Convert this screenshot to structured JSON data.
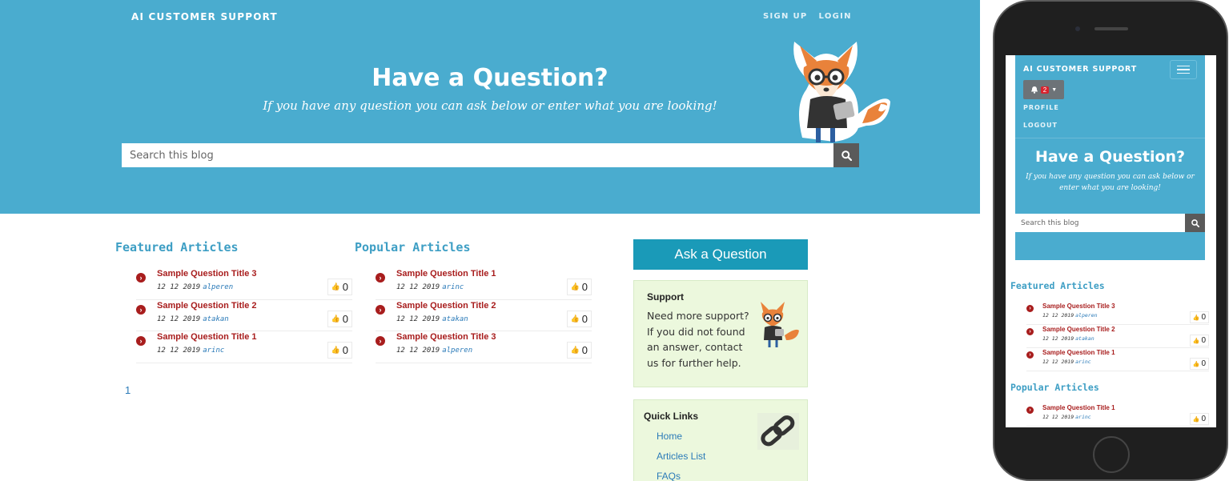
{
  "site": {
    "brand": "AI CUSTOMER SUPPORT",
    "nav": [
      "SIGN UP",
      "LOGIN"
    ]
  },
  "hero": {
    "title": "Have a Question?",
    "subtitle": "If you have any question you can ask below or enter what you are looking!",
    "search_placeholder": "Search this blog"
  },
  "featured": {
    "heading": "Featured Articles",
    "items": [
      {
        "title": "Sample Question Title 3",
        "date": "12 12 2019",
        "author": "alperen",
        "votes": "0"
      },
      {
        "title": "Sample Question Title 2",
        "date": "12 12 2019",
        "author": "atakan",
        "votes": "0"
      },
      {
        "title": "Sample Question Title 1",
        "date": "12 12 2019",
        "author": "arinc",
        "votes": "0"
      }
    ]
  },
  "popular": {
    "heading": "Popular Articles",
    "items": [
      {
        "title": "Sample Question Title 1",
        "date": "12 12 2019",
        "author": "arinc",
        "votes": "0"
      },
      {
        "title": "Sample Question Title 2",
        "date": "12 12 2019",
        "author": "atakan",
        "votes": "0"
      },
      {
        "title": "Sample Question Title 3",
        "date": "12 12 2019",
        "author": "alperen",
        "votes": "0"
      }
    ]
  },
  "pagination": {
    "page": "1"
  },
  "sidebar": {
    "ask_button": "Ask a Question",
    "support": {
      "heading": "Support",
      "text": "Need more support? If you did not found an answer, contact us for further help."
    },
    "quick_links": {
      "heading": "Quick Links",
      "links": [
        "Home",
        "Articles List",
        "FAQs"
      ]
    }
  },
  "mobile": {
    "brand": "AI CUSTOMER SUPPORT",
    "notification_count": "2",
    "menu": [
      "PROFILE",
      "LOGOUT"
    ],
    "title": "Have a Question?",
    "subtitle": "If you have any question you can ask below or enter what you are looking!",
    "search_placeholder": "Search this blog",
    "featured_heading": "Featured Articles",
    "featured": [
      {
        "title": "Sample Question Title 3",
        "date": "12 12 2019",
        "author": "alperen",
        "votes": "0"
      },
      {
        "title": "Sample Question Title 2",
        "date": "12 12 2019",
        "author": "atakan",
        "votes": "0"
      },
      {
        "title": "Sample Question Title 1",
        "date": "12 12 2019",
        "author": "arinc",
        "votes": "0"
      }
    ],
    "popular_heading": "Popular Articles",
    "popular": [
      {
        "title": "Sample Question Title 1",
        "date": "12 12 2019",
        "author": "arinc",
        "votes": "0"
      }
    ]
  },
  "icons": {
    "search": "search-icon",
    "bullet": "circle-chevron-right-icon",
    "votes": "thumbs-up-icon",
    "bell": "bell-icon",
    "caret": "caret-down-icon",
    "menu": "hamburger-menu-icon",
    "mascot": "fox-mascot-icon",
    "chain": "chain-link-icon"
  },
  "colors": {
    "hero": "#4aaccf",
    "accent_title": "#a81d1d",
    "heading": "#3d9ec4",
    "ask_button": "#1a9ab8",
    "sidebar_box": "#ecf8dd"
  }
}
